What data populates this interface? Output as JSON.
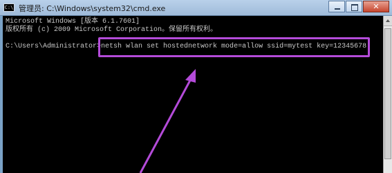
{
  "window": {
    "title": "管理员: C:\\Windows\\system32\\cmd.exe",
    "icon": "cmd-icon",
    "controls": {
      "minimize": "minimize-icon",
      "maximize": "maximize-icon",
      "close": "close-icon"
    }
  },
  "console": {
    "line1": "Microsoft Windows [版本 6.1.7601]",
    "line2": "版权所有 (c) 2009 Microsoft Corporation。保留所有权利。",
    "prompt": "C:\\Users\\Administrator>",
    "command": "netsh wlan set hostednetwork mode=allow ssid=mytest key=12345678"
  },
  "annotation": {
    "color": "#b44bd9"
  }
}
